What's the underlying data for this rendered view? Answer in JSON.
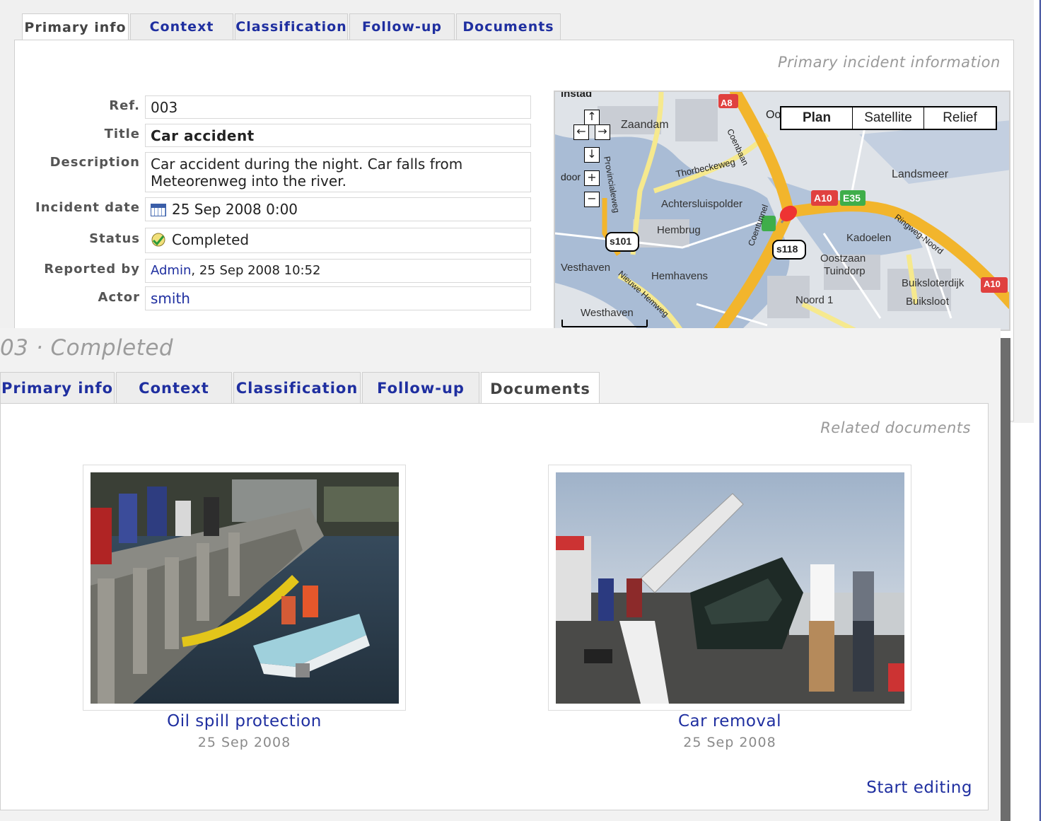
{
  "back_panel": {
    "tabs": [
      {
        "label": "Primary info",
        "active": true
      },
      {
        "label": "Context",
        "active": false
      },
      {
        "label": "Classification",
        "active": false
      },
      {
        "label": "Follow-up",
        "active": false
      },
      {
        "label": "Documents",
        "active": false
      }
    ],
    "section_title": "Primary incident information",
    "fields": {
      "ref": {
        "label": "Ref.",
        "value": "003"
      },
      "title": {
        "label": "Title",
        "value": "Car accident"
      },
      "description": {
        "label": "Description",
        "value": "Car accident during the night. Car falls from Meteorenweg into the river."
      },
      "incident_date": {
        "label": "Incident date",
        "value": "25 Sep 2008 0:00"
      },
      "status": {
        "label": "Status",
        "value": "Completed"
      },
      "reported_by": {
        "label": "Reported by",
        "user": "Admin",
        "value": ", 25 Sep 2008 10:52"
      },
      "actor": {
        "label": "Actor",
        "value": "smith"
      }
    },
    "map": {
      "types": [
        "Plan",
        "Satellite",
        "Relief"
      ],
      "selected_type": "Plan",
      "controls": {
        "up": "↑",
        "left": "←",
        "right": "→",
        "down": "↓",
        "zoom_in": "+",
        "zoom_out": "−"
      },
      "labels": {
        "zaandam": "Zaandam",
        "thorbeckeweg": "Thorbeckeweg",
        "landsmeer": "Landsmeer",
        "achtersluispolder": "Achtersluispolder",
        "hembrug": "Hembrug",
        "kadoelen": "Kadoelen",
        "oostzaan": "Oostzaan",
        "tuindorp": "Tuindorp",
        "vesthaven": "Vesthaven",
        "hemhavens": "Hemhavens",
        "buiksloterdijk": "Buiksloterdijk",
        "buiksloot": "Buiksloot",
        "noord1": "Noord 1",
        "westhaven": "Westhaven",
        "provincialeweg": "Provincialeweg",
        "coenbaan": "Coenbaan",
        "coentunnel": "Coentunnel",
        "nieuwe_hemweg": "Nieuwe Hemweg",
        "ringweg_noord": "Ringweg-Noord",
        "instad": "instad",
        "door": "door",
        "oo": "Oo",
        "s101": "s101",
        "s118": "s118",
        "a8": "A8",
        "a10": "A10",
        "a10b": "A10",
        "e35": "E35"
      }
    }
  },
  "front_panel": {
    "heading": "03 · Completed",
    "tabs": [
      {
        "label": "Primary info",
        "active": false
      },
      {
        "label": "Context",
        "active": false
      },
      {
        "label": "Classification",
        "active": false
      },
      {
        "label": "Follow-up",
        "active": false
      },
      {
        "label": "Documents",
        "active": true
      }
    ],
    "section_title": "Related documents",
    "documents": [
      {
        "title": "Oil spill protection",
        "date": "25 Sep 2008"
      },
      {
        "title": "Car removal",
        "date": "25 Sep 2008"
      }
    ],
    "start_editing": "Start editing"
  },
  "colors": {
    "link": "#1f2fa0",
    "tab_bg": "#ededed",
    "panel_bg": "#f2f2f2",
    "muted_heading": "#9c9c9c",
    "motorway": "#f2b52c",
    "road": "#f6e98e",
    "water": "#a9bcd5",
    "shield_red": "#e0413f",
    "shield_green": "#3fae4a"
  }
}
